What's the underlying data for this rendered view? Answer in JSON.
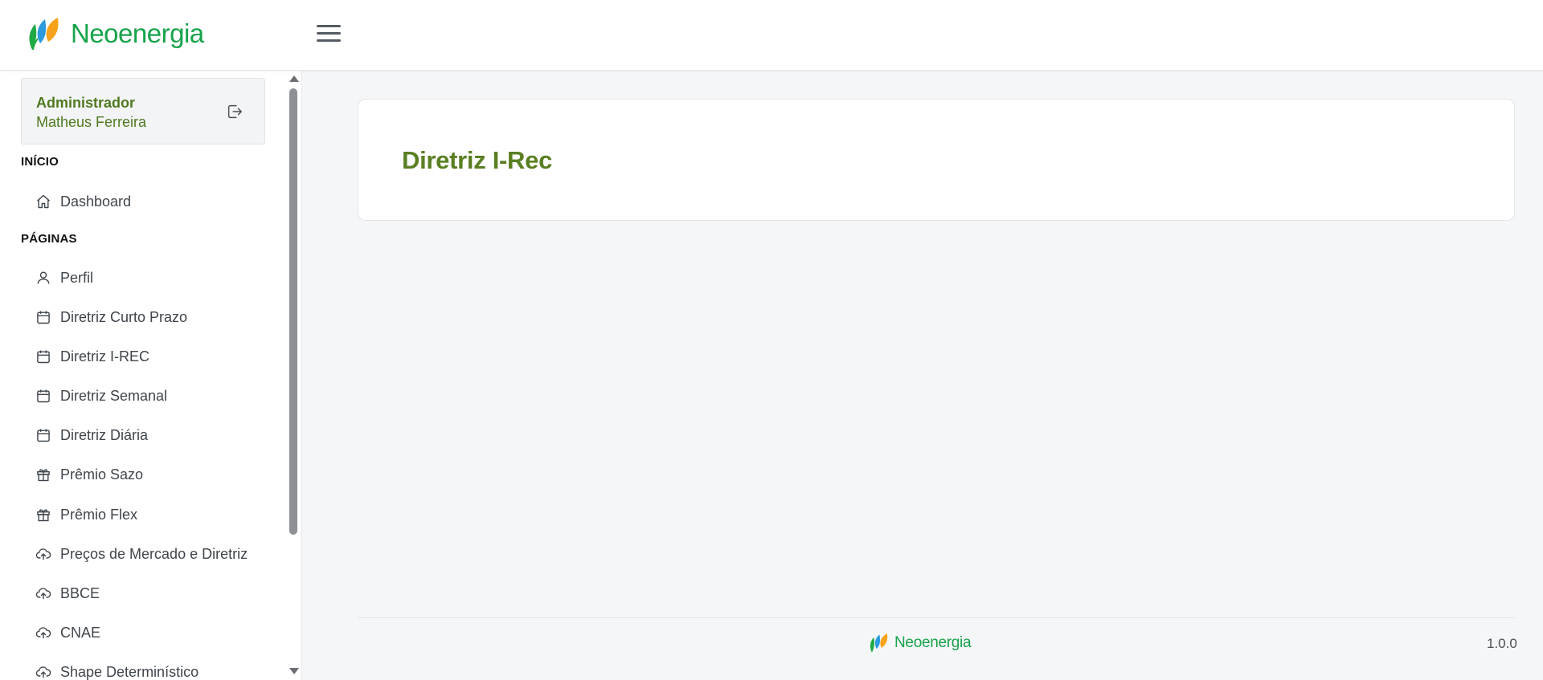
{
  "brand": {
    "name": "Neoenergia",
    "color": "#17a34a"
  },
  "user": {
    "role": "Administrador",
    "name": "Matheus Ferreira"
  },
  "sidebar": {
    "sections": [
      {
        "title": "INÍCIO"
      },
      {
        "title": "PÁGINAS"
      }
    ],
    "items": [
      {
        "label": "Dashboard",
        "icon": "home-icon"
      },
      {
        "label": "Perfil",
        "icon": "user-icon"
      },
      {
        "label": "Diretriz Curto Prazo",
        "icon": "calendar-icon"
      },
      {
        "label": "Diretriz I-REC",
        "icon": "calendar-icon"
      },
      {
        "label": "Diretriz Semanal",
        "icon": "calendar-icon"
      },
      {
        "label": "Diretriz Diária",
        "icon": "calendar-icon"
      },
      {
        "label": "Prêmio Sazo",
        "icon": "gift-icon"
      },
      {
        "label": "Prêmio Flex",
        "icon": "gift-icon"
      },
      {
        "label": "Preços de Mercado e Diretriz",
        "icon": "cloud-upload-icon"
      },
      {
        "label": "BBCE",
        "icon": "cloud-upload-icon"
      },
      {
        "label": "CNAE",
        "icon": "cloud-upload-icon"
      },
      {
        "label": "Shape Determinístico",
        "icon": "cloud-upload-icon"
      }
    ]
  },
  "main": {
    "title": "Diretriz I-Rec",
    "title_color": "#5a7f23"
  },
  "footer": {
    "version": "1.0.0"
  }
}
